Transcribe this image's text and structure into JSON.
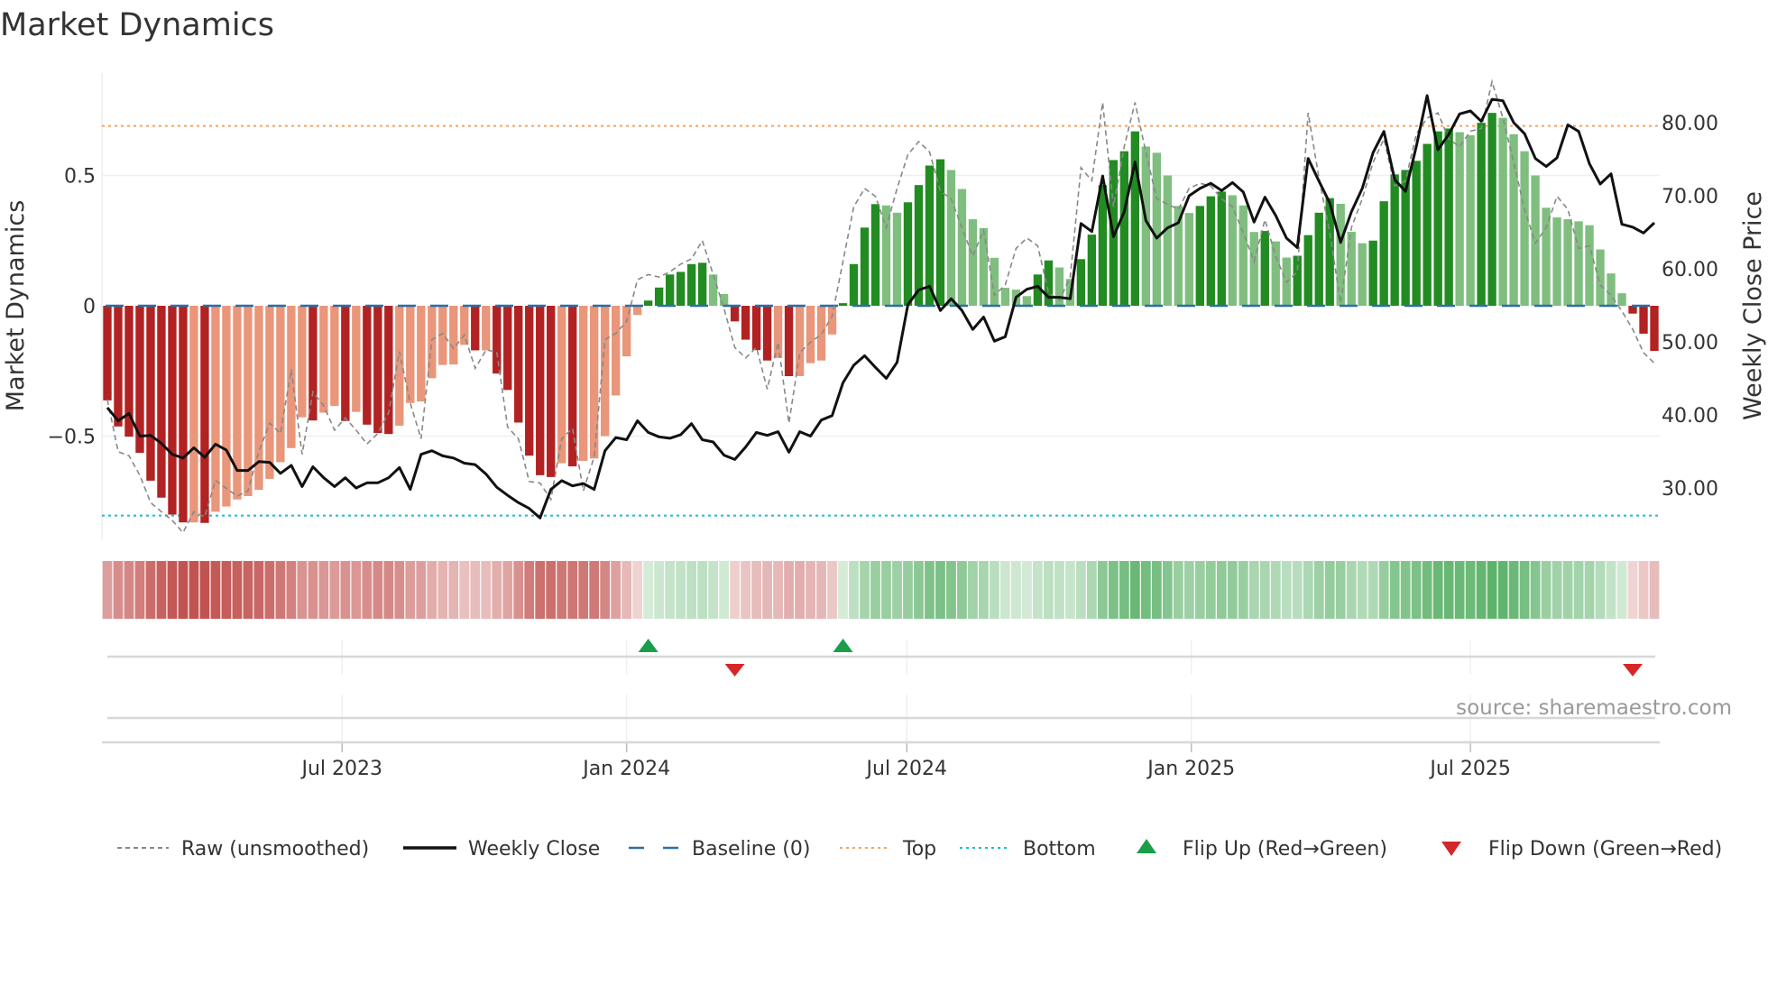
{
  "chart_data": {
    "type": "bar",
    "title": "Market Dynamics",
    "ylabel_left": "Market Dynamics",
    "ylabel_right": "Weekly Close Price",
    "source": "source: sharemaestro.com",
    "ylim_left": [
      -0.92,
      0.88
    ],
    "ylim_right_ticks": [
      "30.00",
      "40.00",
      "50.00",
      "60.00",
      "70.00",
      "80.00"
    ],
    "ylim_right_values": [
      30,
      40,
      50,
      60,
      70,
      80
    ],
    "left_ticks": [
      {
        "v": 0.5,
        "label": "0.5"
      },
      {
        "v": 0,
        "label": "0"
      },
      {
        "v": -0.5,
        "label": "−0.5"
      }
    ],
    "x_ticks": [
      {
        "x": 21.7,
        "label": "Jul 2023"
      },
      {
        "x": 48.0,
        "label": "Jan 2024"
      },
      {
        "x": 73.9,
        "label": "Jul 2024"
      },
      {
        "x": 100.2,
        "label": "Jan 2025"
      },
      {
        "x": 126.0,
        "label": "Jul 2025"
      }
    ],
    "top_level": 0.69,
    "bottom_level": -0.805,
    "baseline": 0,
    "colors": {
      "neg_strong": "#b22222",
      "neg_weak": "#e9967a",
      "pos_strong": "#228b22",
      "pos_weak": "#80be80",
      "baseline": "#2b6ea6",
      "top": "#f4a460",
      "bottom": "#17becf",
      "raw": "#888888",
      "close": "#111111",
      "flip_up": "#1a9e4a",
      "flip_down": "#d62728"
    },
    "smoothed": [
      -0.363,
      -0.463,
      -0.502,
      -0.564,
      -0.671,
      -0.736,
      -0.801,
      -0.831,
      -0.831,
      -0.833,
      -0.79,
      -0.77,
      -0.743,
      -0.73,
      -0.706,
      -0.664,
      -0.6,
      -0.546,
      -0.428,
      -0.44,
      -0.41,
      -0.384,
      -0.442,
      -0.407,
      -0.456,
      -0.488,
      -0.492,
      -0.46,
      -0.373,
      -0.367,
      -0.278,
      -0.227,
      -0.225,
      -0.15,
      -0.171,
      -0.171,
      -0.26,
      -0.323,
      -0.448,
      -0.575,
      -0.65,
      -0.657,
      -0.604,
      -0.616,
      -0.595,
      -0.586,
      -0.5,
      -0.344,
      -0.194,
      -0.035,
      0.02,
      0.07,
      0.12,
      0.13,
      0.16,
      0.165,
      0.12,
      0.045,
      -0.06,
      -0.13,
      -0.17,
      -0.21,
      -0.2,
      -0.27,
      -0.27,
      -0.22,
      -0.21,
      -0.11,
      0.01,
      0.16,
      0.3,
      0.39,
      0.385,
      0.357,
      0.397,
      0.463,
      0.538,
      0.562,
      0.521,
      0.448,
      0.332,
      0.298,
      0.184,
      0.069,
      0.062,
      0.037,
      0.12,
      0.174,
      0.147,
      0.103,
      0.179,
      0.273,
      0.463,
      0.559,
      0.593,
      0.669,
      0.611,
      0.587,
      0.5,
      0.383,
      0.356,
      0.383,
      0.42,
      0.438,
      0.424,
      0.385,
      0.283,
      0.287,
      0.247,
      0.185,
      0.192,
      0.271,
      0.357,
      0.413,
      0.391,
      0.284,
      0.24,
      0.25,
      0.401,
      0.504,
      0.521,
      0.556,
      0.621,
      0.669,
      0.68,
      0.666,
      0.654,
      0.702,
      0.74,
      0.721,
      0.658,
      0.593,
      0.5,
      0.376,
      0.339,
      0.332,
      0.324,
      0.309,
      0.216,
      0.124,
      0.048,
      -0.03,
      -0.107,
      -0.173
    ],
    "raw": [
      -0.36,
      -0.56,
      -0.575,
      -0.65,
      -0.755,
      -0.79,
      -0.824,
      -0.87,
      -0.79,
      -0.81,
      -0.67,
      -0.7,
      -0.73,
      -0.71,
      -0.56,
      -0.45,
      -0.49,
      -0.245,
      -0.57,
      -0.33,
      -0.384,
      -0.477,
      -0.43,
      -0.477,
      -0.53,
      -0.49,
      -0.41,
      -0.176,
      -0.373,
      -0.51,
      -0.13,
      -0.106,
      -0.164,
      -0.112,
      -0.24,
      -0.17,
      -0.176,
      -0.465,
      -0.51,
      -0.674,
      -0.68,
      -0.743,
      -0.51,
      -0.47,
      -0.71,
      -0.58,
      -0.13,
      -0.106,
      -0.06,
      0.1,
      0.12,
      0.11,
      0.13,
      0.16,
      0.18,
      0.25,
      0.12,
      -0.01,
      -0.16,
      -0.2,
      -0.16,
      -0.32,
      -0.14,
      -0.45,
      -0.18,
      -0.14,
      -0.11,
      -0.04,
      0.17,
      0.38,
      0.45,
      0.42,
      0.3,
      0.45,
      0.58,
      0.63,
      0.59,
      0.44,
      0.41,
      0.3,
      0.19,
      0.29,
      0.04,
      0.08,
      0.22,
      0.26,
      0.23,
      0.05,
      0.02,
      0.11,
      0.53,
      0.48,
      0.78,
      0.38,
      0.61,
      0.78,
      0.59,
      0.41,
      0.39,
      0.37,
      0.45,
      0.47,
      0.46,
      0.41,
      0.38,
      0.28,
      0.17,
      0.33,
      0.19,
      0.09,
      0.13,
      0.74,
      0.49,
      0.28,
      0.01,
      0.3,
      0.41,
      0.55,
      0.64,
      0.46,
      0.48,
      0.66,
      0.72,
      0.74,
      0.64,
      0.61,
      0.67,
      0.68,
      0.86,
      0.72,
      0.55,
      0.37,
      0.24,
      0.3,
      0.42,
      0.37,
      0.22,
      0.23,
      0.08,
      0.04,
      -0.02,
      -0.09,
      -0.18,
      -0.22
    ],
    "close": [
      41.0,
      39.2,
      40.2,
      37.1,
      37.2,
      36.1,
      34.6,
      34.1,
      35.5,
      34.2,
      36.0,
      35.2,
      32.4,
      32.4,
      33.6,
      33.5,
      32.0,
      33.1,
      30.2,
      32.9,
      31.4,
      30.2,
      31.4,
      30.0,
      30.7,
      30.7,
      31.4,
      32.8,
      29.8,
      34.6,
      35.1,
      34.4,
      34.1,
      33.4,
      33.2,
      31.9,
      30.1,
      29.0,
      28.0,
      27.2,
      25.9,
      29.8,
      31.0,
      30.3,
      30.6,
      29.8,
      35.1,
      36.9,
      36.6,
      39.2,
      37.6,
      37.0,
      36.8,
      37.3,
      38.8,
      36.6,
      36.3,
      34.5,
      33.9,
      35.6,
      37.6,
      37.2,
      37.7,
      34.9,
      37.7,
      37.1,
      39.3,
      39.9,
      44.4,
      46.8,
      48.1,
      46.5,
      45.0,
      47.2,
      55.1,
      57.1,
      57.6,
      54.3,
      55.9,
      54.3,
      51.7,
      53.4,
      50.1,
      50.7,
      56.1,
      57.2,
      57.6,
      56.1,
      56.1,
      55.9,
      66.2,
      65.1,
      72.7,
      64.4,
      67.8,
      74.6,
      66.6,
      64.2,
      65.6,
      66.3,
      70.0,
      71.0,
      71.7,
      70.7,
      71.8,
      70.5,
      66.4,
      69.8,
      67.3,
      64.2,
      62.9,
      75.1,
      72.0,
      69.0,
      63.6,
      67.8,
      71.0,
      75.9,
      78.8,
      72.2,
      70.6,
      76.8,
      83.7,
      76.3,
      78.4,
      81.2,
      81.6,
      80.2,
      83.2,
      83.0,
      80.0,
      78.5,
      75.1,
      74.0,
      75.2,
      79.7,
      78.8,
      74.4,
      71.6,
      73.0,
      66.1,
      65.7,
      64.9,
      66.3
    ],
    "flip_up_index": [
      50,
      68
    ],
    "flip_down_index": [
      58,
      141
    ],
    "legend": {
      "position": "bottom",
      "items": [
        {
          "key": "raw",
          "label": "Raw (unsmoothed)"
        },
        {
          "key": "close",
          "label": "Weekly Close"
        },
        {
          "key": "baseline",
          "label": "Baseline (0)"
        },
        {
          "key": "top",
          "label": "Top"
        },
        {
          "key": "bottom",
          "label": "Bottom"
        },
        {
          "key": "flip_up",
          "label": "Flip Up (Red→Green)"
        },
        {
          "key": "flip_down",
          "label": "Flip Down (Green→Red)"
        }
      ]
    }
  }
}
